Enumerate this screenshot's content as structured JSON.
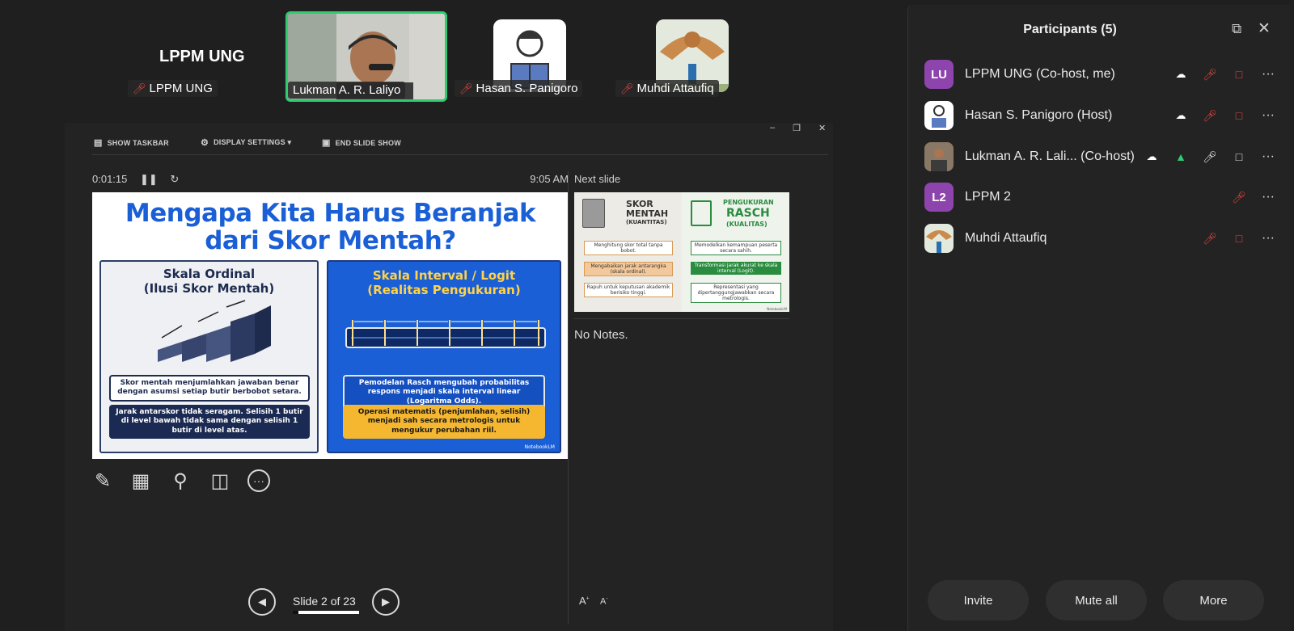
{
  "gallery": {
    "self_label": "LPPM UNG",
    "tiles": [
      {
        "name": "LPPM UNG"
      },
      {
        "name": "Lukman A. R. Laliyo"
      },
      {
        "name": "Hasan S. Panigoro"
      },
      {
        "name": "Muhdi Attaufiq"
      }
    ]
  },
  "presenter": {
    "toolbar": {
      "show_taskbar": "SHOW TASKBAR",
      "display_settings": "DISPLAY SETTINGS ▾",
      "end_show": "END SLIDE SHOW"
    },
    "timer": "0:01:15",
    "clock": "9:05 AM",
    "next_slide_label": "Next slide",
    "notes": "No Notes.",
    "slide_counter": "Slide 2 of 23",
    "progress": 0.087
  },
  "slide": {
    "title_line1": "Mengapa Kita Harus Beranjak",
    "title_line2": "dari Skor Mentah?",
    "left_heading1": "Skala Ordinal",
    "left_heading2": "(Ilusi Skor Mentah)",
    "left_box1": "Skor mentah menjumlahkan jawaban benar dengan asumsi setiap butir berbobot setara.",
    "left_box2": "Jarak antarskor tidak seragam. Selisih 1 butir di level bawah tidak sama dengan selisih 1 butir di level atas.",
    "right_heading1": "Skala Interval / Logit",
    "right_heading2": "(Realitas Pengukuran)",
    "right_box1": "Pemodelan Rasch mengubah probabilitas respons menjadi skala interval linear (Logaritma Odds).",
    "right_box2": "Operasi matematis (penjumlahan, selisih) menjadi sah secara metrologis untuk mengukur perubahan riil.",
    "footer": "NotebookLM"
  },
  "next_slide": {
    "left_title1": "SKOR",
    "left_title2": "MENTAH",
    "left_title3": "(KUANTITAS)",
    "left_b1": "Menghitung skor total tanpa bobot.",
    "left_b2": "Mengabaikan jarak antarangka (skala ordinal).",
    "left_b3": "Rapuh untuk keputusan akademik berisiko tinggi.",
    "right_title1": "PENGUKURAN",
    "right_title2": "RASCH",
    "right_title3": "(KUALITAS)",
    "right_b1": "Memodelkan kemampuan peserta secara sahih.",
    "right_b2": "Transformasi jarak akurat ke skala interval (Logit).",
    "right_b3": "Representasi yang dipertanggungjawabkan secara metrologis.",
    "footer": "NotebookLM"
  },
  "participants": {
    "title": "Participants (5)",
    "list": [
      {
        "initials": "LU",
        "name": "LPPM UNG (Co-host, me)",
        "color": "#8e44ad"
      },
      {
        "initials": "",
        "name": "Hasan S. Panigoro (Host)",
        "color": "#ffffff"
      },
      {
        "initials": "",
        "name": "Lukman A. R. Lali...  (Co-host)",
        "color": "#6b5a4a"
      },
      {
        "initials": "L2",
        "name": "LPPM 2",
        "color": "#8e44ad"
      },
      {
        "initials": "",
        "name": "Muhdi Attaufiq",
        "color": "#c98a4b"
      }
    ],
    "buttons": {
      "invite": "Invite",
      "mute_all": "Mute all",
      "more": "More"
    }
  },
  "colors": {
    "accent_green": "#2ecc71",
    "mic_off": "#e0443e",
    "slide_blue": "#1a5fd6"
  }
}
